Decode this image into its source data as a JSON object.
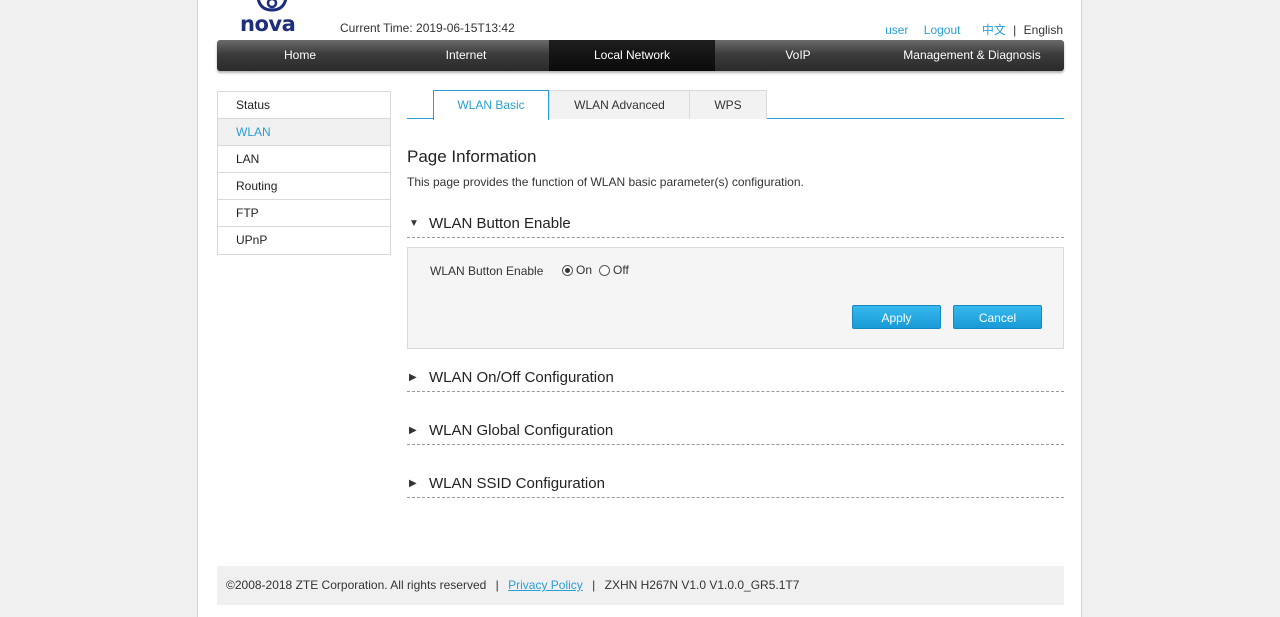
{
  "header": {
    "logo_text": "nova",
    "current_time": "Current Time: 2019-06-15T13:42",
    "user_link": "user",
    "logout_link": "Logout",
    "lang_cn": "中文",
    "lang_sep": "|",
    "lang_en": "English"
  },
  "nav": {
    "items": [
      {
        "label": "Home"
      },
      {
        "label": "Internet"
      },
      {
        "label": "Local Network"
      },
      {
        "label": "VoIP"
      },
      {
        "label": "Management & Diagnosis"
      }
    ],
    "active": "Local Network"
  },
  "sidebar": {
    "items": [
      {
        "label": "Status"
      },
      {
        "label": "WLAN"
      },
      {
        "label": "LAN"
      },
      {
        "label": "Routing"
      },
      {
        "label": "FTP"
      },
      {
        "label": "UPnP"
      }
    ],
    "active": "WLAN"
  },
  "tabs": {
    "items": [
      {
        "label": "WLAN Basic"
      },
      {
        "label": "WLAN Advanced"
      },
      {
        "label": "WPS"
      }
    ],
    "active": "WLAN Basic"
  },
  "main": {
    "page_title": "Page Information",
    "page_desc": "This page provides the function of WLAN basic parameter(s) configuration.",
    "sections": [
      {
        "label": "WLAN Button Enable",
        "expanded": true
      },
      {
        "label": "WLAN On/Off Configuration",
        "expanded": false
      },
      {
        "label": "WLAN Global Configuration",
        "expanded": false
      },
      {
        "label": "WLAN SSID Configuration",
        "expanded": false
      }
    ],
    "panel": {
      "field_label": "WLAN Button Enable",
      "option_on": "On",
      "option_off": "Off",
      "selected": "On",
      "apply_label": "Apply",
      "cancel_label": "Cancel"
    }
  },
  "footer": {
    "copyright": "©2008-2018 ZTE Corporation. All rights reserved",
    "sep": "|",
    "privacy_label": "Privacy Policy",
    "version": "ZXHN H267N V1.0 V1.0.0_GR5.1T7"
  },
  "colors": {
    "accent": "#2a9fd6",
    "brand": "#1d2f7c",
    "nav_bg": "#3c3c3c",
    "button": "#1a9ad6"
  },
  "icons": {
    "expanded": "triangle-down-icon",
    "collapsed": "triangle-right-icon"
  }
}
